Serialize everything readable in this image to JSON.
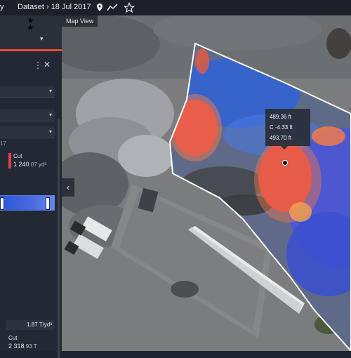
{
  "topbar": {
    "left_word": "y",
    "dataset_label": "Dataset › 18 Jul 2017",
    "icons": [
      "location-pin-icon",
      "trend-line-icon",
      "star-outline-icon"
    ]
  },
  "map": {
    "tab_label": "Map View",
    "tooltip": {
      "line1": "489.36 ft",
      "line2": "C -4.33 ft",
      "line3": "493.70 ft"
    }
  },
  "panel": {
    "cut_label": "Cut",
    "cut_value_main": "1 240",
    "cut_value_decimal": ".07 yd³",
    "year_fragment": "17",
    "density_value": "1.87 T/yd³",
    "cut2_label": "Cut",
    "cut2_value_main": "2 318",
    "cut2_value_decimal": ".93 T"
  },
  "colors": {
    "cut": "#e0424a",
    "fill": "#2b58d6",
    "panel_bg": "#222834",
    "topbar_bg": "#1b2029"
  }
}
